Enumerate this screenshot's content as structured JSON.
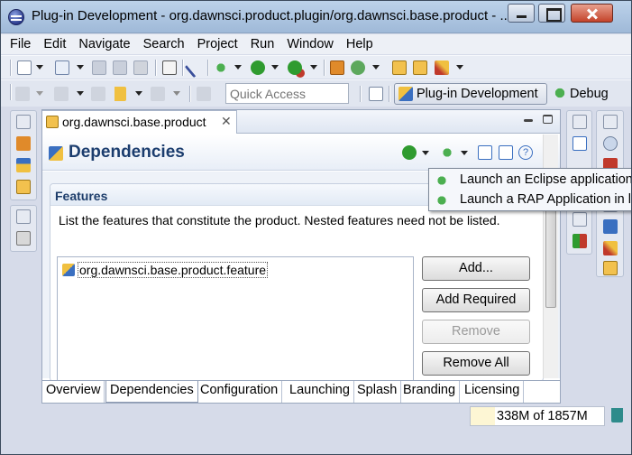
{
  "window": {
    "title": "Plug-in Development - org.dawnsci.product.plugin/org.dawnsci.base.product - ..."
  },
  "menu": [
    "File",
    "Edit",
    "Navigate",
    "Search",
    "Project",
    "Run",
    "Window",
    "Help"
  ],
  "toolbar": {
    "quick_access_placeholder": "Quick Access",
    "perspectives": {
      "active": "Plug-in Development",
      "other": "Debug"
    }
  },
  "editor": {
    "tab_label": "org.dawnsci.base.product",
    "page_title": "Dependencies",
    "section": {
      "title": "Features",
      "description": "List the features that constitute the product.  Nested features need not be listed.",
      "items": [
        "org.dawnsci.base.product.feature"
      ],
      "buttons": {
        "add": "Add...",
        "add_required": "Add Required",
        "remove": "Remove",
        "remove_all": "Remove All"
      }
    },
    "page_tabs": [
      "Overview",
      "Dependencies",
      "Configuration",
      "Launching",
      "Splash",
      "Branding",
      "Licensing"
    ],
    "active_page_tab": "Dependencies"
  },
  "popup_menu": [
    "Launch an Eclipse application",
    "Launch a RAP Application in l"
  ],
  "status": {
    "heap_text": "338M of 1857M",
    "heap_used_fraction": 0.18
  },
  "colors": {
    "title_bar": "#a9c3e0",
    "header_text": "#1b3d6e",
    "accent_green": "#2f9b2f"
  }
}
